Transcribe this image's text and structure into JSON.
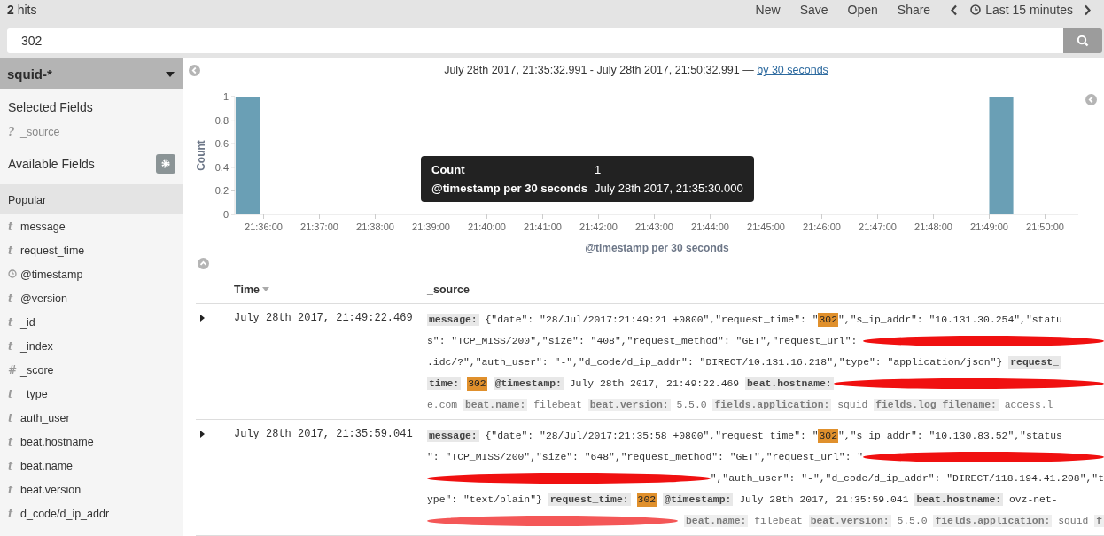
{
  "top_bar": {
    "hits": "**2** hits",
    "menu": [
      "New",
      "Save",
      "Open",
      "Share"
    ],
    "time_range": "Last 15 minutes"
  },
  "search": {
    "value": "302"
  },
  "sidebar": {
    "index_pattern": "squid-*",
    "selected_title": "Selected Fields",
    "selected_fields": [
      {
        "mark": "?",
        "name": "_source"
      }
    ],
    "available_title": "Available Fields",
    "popular_title": "Popular",
    "fields": [
      {
        "kind": "text",
        "mark": "t",
        "name": "message"
      },
      {
        "kind": "text",
        "mark": "t",
        "name": "request_time"
      },
      {
        "kind": "date",
        "name": "@timestamp"
      },
      {
        "kind": "text",
        "mark": "t",
        "name": "@version"
      },
      {
        "kind": "text",
        "mark": "t",
        "name": "_id"
      },
      {
        "kind": "text",
        "mark": "t",
        "name": "_index"
      },
      {
        "kind": "text",
        "mark": "#",
        "name": "_score"
      },
      {
        "kind": "text",
        "mark": "t",
        "name": "_type"
      },
      {
        "kind": "text",
        "mark": "t",
        "name": "auth_user"
      },
      {
        "kind": "text",
        "mark": "t",
        "name": "beat.hostname"
      },
      {
        "kind": "text",
        "mark": "t",
        "name": "beat.name"
      },
      {
        "kind": "text",
        "mark": "t",
        "name": "beat.version"
      },
      {
        "kind": "text",
        "mark": "t",
        "name": "d_code/d_ip_addr"
      }
    ]
  },
  "histogram": {
    "range": "July 28th 2017, 21:35:32.991 - July 28th 2017, 21:50:32.991 —",
    "interval_link": "by 30 seconds",
    "chart_data": {
      "type": "bar",
      "xlabel": "@timestamp per 30 seconds",
      "ylabel": "Count",
      "categories": [
        null,
        "21:36:00",
        null,
        "21:37:00",
        null,
        "21:38:00",
        null,
        "21:39:00",
        null,
        "21:40:00",
        null,
        "21:41:00",
        null,
        "21:42:00",
        null,
        "21:43:00",
        null,
        "21:44:00",
        null,
        "21:45:00",
        null,
        "21:46:00",
        null,
        "21:47:00",
        null,
        "21:48:00",
        null,
        "21:49:00",
        null,
        "21:50:00"
      ],
      "series": [
        {
          "color": "#6a9fb5",
          "values": [
            1,
            0,
            0,
            0,
            0,
            0,
            0,
            0,
            0,
            0,
            0,
            0,
            0,
            0,
            0,
            0,
            0,
            0,
            0,
            0,
            0,
            0,
            0,
            0,
            0,
            0,
            0,
            1,
            0,
            0
          ]
        }
      ],
      "ylim": [
        0,
        1
      ],
      "yticks": [
        0,
        0.2,
        0.4,
        0.6,
        0.8,
        1
      ]
    },
    "tooltip": [
      {
        "label": "Count",
        "value": "1"
      },
      {
        "label": "@timestamp per 30 seconds",
        "value": "July 28th 2017, 21:35:30.000"
      }
    ]
  },
  "table": {
    "columns": [
      "Time",
      "_source"
    ],
    "rows": [
      {
        "time": "July 28th 2017, 21:49:22.469",
        "lines": [
          [
            {
              "kind": "key",
              "text": "message:"
            },
            {
              "kind": "text",
              "text": " {\"date\": \"28/Jul/2017:21:49:21 +0800\",\"request_time\": \""
            },
            {
              "kind": "hit",
              "text": "302"
            },
            {
              "kind": "text",
              "text": "\",\"s_ip_addr\": \"10.131.30.254\",\"statu"
            }
          ],
          [
            {
              "kind": "text",
              "text": "s\": \"TCP_MISS/200\",\"size\": \"408\",\"request_method\": \"GET\",\"request_url\": "
            },
            {
              "kind": "redacted"
            }
          ],
          [
            {
              "kind": "text",
              "text": ".idc/?\",\"auth_user\": \"-\",\"d_code/d_ip_addr\": \"DIRECT/10.131.16.218\",\"type\": \"application/json\"} "
            },
            {
              "kind": "key",
              "text": "request_"
            }
          ],
          [
            {
              "kind": "key",
              "text": "time:"
            },
            {
              "kind": "hit",
              "text": "302"
            },
            {
              "kind": "key",
              "text": "@timestamp:"
            },
            {
              "kind": "text",
              "text": " July 28th 2017, 21:49:22.469 "
            },
            {
              "kind": "key",
              "text": "beat.hostname:"
            },
            {
              "kind": "redacted"
            }
          ],
          [
            {
              "kind": "text",
              "text": "e.com "
            },
            {
              "kind": "key",
              "text": "beat.name:"
            },
            {
              "kind": "text",
              "text": " filebeat "
            },
            {
              "kind": "key",
              "text": "beat.version:"
            },
            {
              "kind": "text",
              "text": " 5.5.0 "
            },
            {
              "kind": "key",
              "text": "fields.application:"
            },
            {
              "kind": "text",
              "text": " squid "
            },
            {
              "kind": "key",
              "text": "fields.log_filename:"
            },
            {
              "kind": "text",
              "text": " access.l"
            }
          ]
        ]
      },
      {
        "time": "July 28th 2017, 21:35:59.041",
        "lines": [
          [
            {
              "kind": "key",
              "text": "message:"
            },
            {
              "kind": "text",
              "text": " {\"date\": \"28/Jul/2017:21:35:58 +0800\",\"request_time\": \""
            },
            {
              "kind": "hit",
              "text": "302"
            },
            {
              "kind": "text",
              "text": "\",\"s_ip_addr\": \"10.130.83.52\",\"status"
            }
          ],
          [
            {
              "kind": "text",
              "text": "\": \"TCP_MISS/200\",\"size\": \"648\",\"request_method\": \"GET\",\"request_url\": \""
            },
            {
              "kind": "redacted"
            }
          ],
          [
            {
              "kind": "redacted"
            },
            {
              "kind": "text",
              "text": "\",\"auth_user\": \"-\",\"d_code/d_ip_addr\": \"DIRECT/118.194.41.208\",\"t"
            }
          ],
          [
            {
              "kind": "text",
              "text": "ype\": \"text/plain\"} "
            },
            {
              "kind": "key",
              "text": "request_time:"
            },
            {
              "kind": "hit",
              "text": "302"
            },
            {
              "kind": "key",
              "text": "@timestamp:"
            },
            {
              "kind": "text",
              "text": " July 28th 2017, 21:35:59.041 "
            },
            {
              "kind": "key",
              "text": "beat.hostname:"
            },
            {
              "kind": "text",
              "text": " ovz-net-"
            }
          ],
          [
            {
              "kind": "redacted"
            },
            {
              "kind": "key",
              "text": "beat.name:"
            },
            {
              "kind": "text",
              "text": " filebeat "
            },
            {
              "kind": "key",
              "text": "beat.version:"
            },
            {
              "kind": "text",
              "text": " 5.5.0 "
            },
            {
              "kind": "key",
              "text": "fields.application:"
            },
            {
              "kind": "text",
              "text": " squid "
            },
            {
              "kind": "key",
              "text": "f"
            }
          ]
        ]
      }
    ]
  }
}
